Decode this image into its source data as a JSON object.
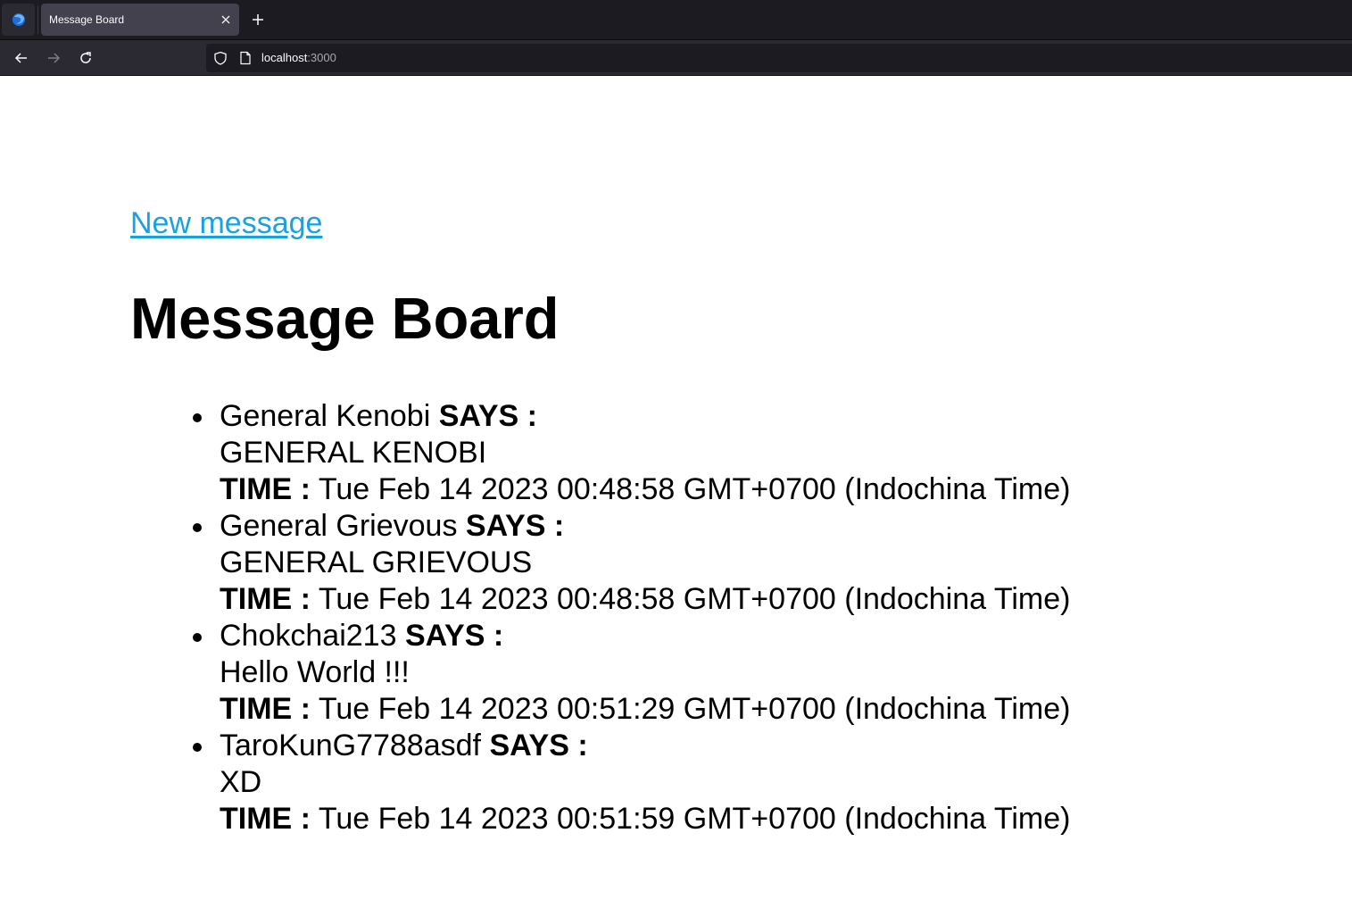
{
  "browser": {
    "tab_title": "Message Board",
    "url_host": "localhost",
    "url_port": ":3000"
  },
  "page": {
    "new_link": "New message",
    "title": "Message Board",
    "says_label": "SAYS :",
    "time_label": "TIME :"
  },
  "messages": [
    {
      "name": "General Kenobi",
      "text": "GENERAL KENOBI",
      "time": "Tue Feb 14 2023 00:48:58 GMT+0700 (Indochina Time)"
    },
    {
      "name": "General Grievous",
      "text": "GENERAL GRIEVOUS",
      "time": "Tue Feb 14 2023 00:48:58 GMT+0700 (Indochina Time)"
    },
    {
      "name": "Chokchai213",
      "text": "Hello World !!!",
      "time": "Tue Feb 14 2023 00:51:29 GMT+0700 (Indochina Time)"
    },
    {
      "name": "TaroKunG7788asdf",
      "text": "XD",
      "time": "Tue Feb 14 2023 00:51:59 GMT+0700 (Indochina Time)"
    }
  ],
  "icons": {
    "app": "firefox-icon",
    "close": "close-icon",
    "new_tab": "plus-icon",
    "back": "arrow-left-icon",
    "forward": "arrow-right-icon",
    "reload": "reload-icon",
    "tracking": "shield-icon",
    "page": "page-icon"
  }
}
